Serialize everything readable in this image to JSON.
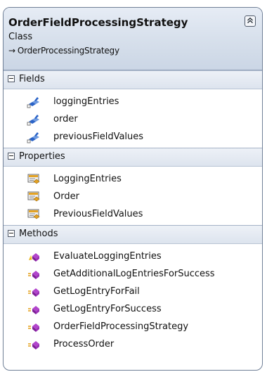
{
  "class_box": {
    "title": "OrderFieldProcessingStrategy",
    "kind": "Class",
    "base_arrow": "→",
    "base_class": "OrderProcessingStrategy",
    "collapse_glyph": "⏶"
  },
  "sections": {
    "fields": {
      "label": "Fields",
      "items": [
        "loggingEntries",
        "order",
        "previousFieldValues"
      ]
    },
    "properties": {
      "label": "Properties",
      "items": [
        "LoggingEntries",
        "Order",
        "PreviousFieldValues"
      ]
    },
    "methods": {
      "label": "Methods",
      "items": [
        "EvaluateLoggingEntries",
        "GetAdditionalLogEntriesForSuccess",
        "GetLogEntryForFail",
        "GetLogEntryForSuccess",
        "OrderFieldProcessingStrategy",
        "ProcessOrder"
      ]
    }
  },
  "icons": {
    "field": "field-icon",
    "property": "property-icon",
    "method_private": "private-method-icon",
    "method_protected": "protected-method-icon"
  },
  "colors": {
    "header_bg": "#d6dfeb",
    "border": "#6f7f96",
    "field_blue": "#2a63c7",
    "method_purple": "#9a2fb5",
    "property_orange": "#e4a324"
  }
}
